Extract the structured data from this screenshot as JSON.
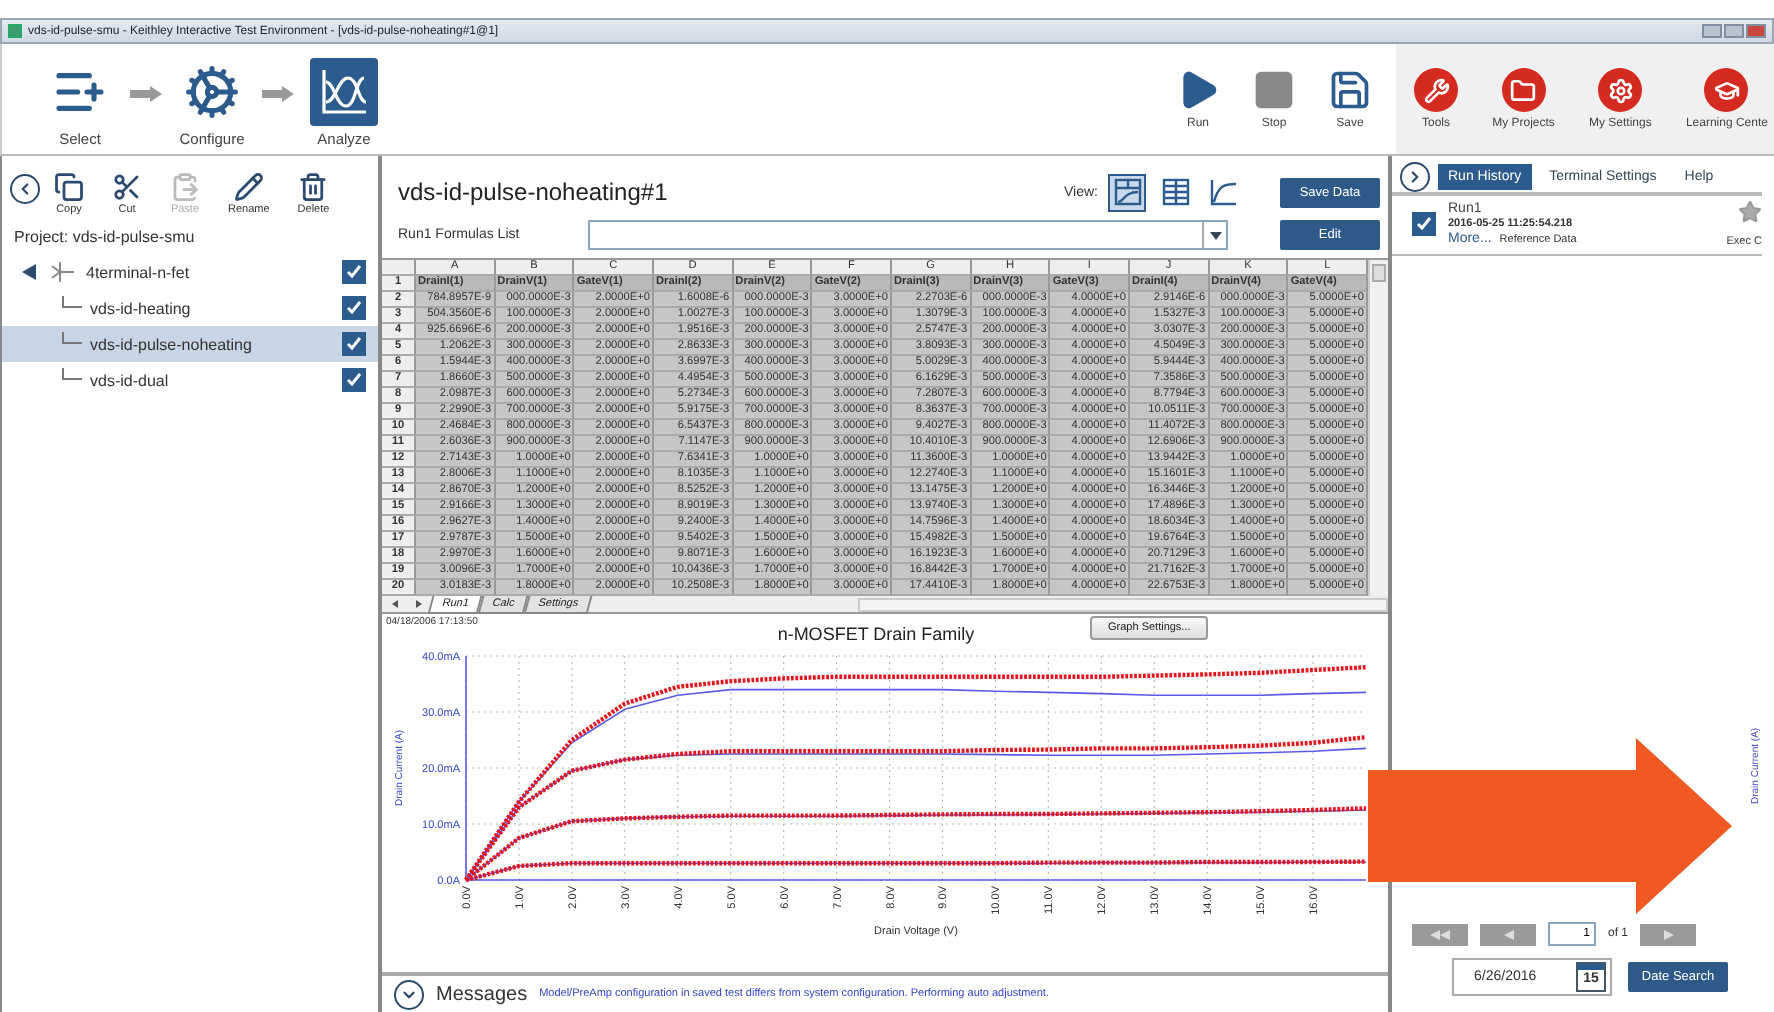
{
  "window": {
    "title": "vds-id-pulse-smu - Keithley Interactive Test Environment - [vds-id-pulse-noheating#1@1]"
  },
  "workflow": [
    {
      "label": "Select",
      "kind": "select",
      "selected": false
    },
    {
      "label": "Configure",
      "kind": "configure",
      "selected": false
    },
    {
      "label": "Analyze",
      "kind": "analyze",
      "selected": true
    }
  ],
  "run_controls": [
    {
      "label": "Run",
      "kind": "run"
    },
    {
      "label": "Stop",
      "kind": "stop"
    },
    {
      "label": "Save",
      "kind": "save"
    }
  ],
  "tools": [
    {
      "label": "Tools",
      "kind": "tools"
    },
    {
      "label": "My Projects",
      "kind": "projects"
    },
    {
      "label": "My Settings",
      "kind": "settings"
    },
    {
      "label": "Learning Cente",
      "kind": "learning"
    }
  ],
  "project_toolbar": [
    {
      "label": "Copy",
      "kind": "copy",
      "disabled": false
    },
    {
      "label": "Cut",
      "kind": "cut",
      "disabled": false
    },
    {
      "label": "Paste",
      "kind": "paste",
      "disabled": true
    },
    {
      "label": "Rename",
      "kind": "rename",
      "disabled": false
    },
    {
      "label": "Delete",
      "kind": "delete",
      "disabled": false
    }
  ],
  "project": {
    "label": "Project: vds-id-pulse-smu",
    "tree": [
      {
        "label": "4terminal-n-fet",
        "expanded": true,
        "checked": true,
        "selected": false,
        "children": [
          {
            "label": "vds-id-heating",
            "checked": true,
            "selected": false
          },
          {
            "label": "vds-id-pulse-noheating",
            "checked": true,
            "selected": true
          },
          {
            "label": "vds-id-dual",
            "checked": true,
            "selected": false
          }
        ]
      }
    ]
  },
  "test": {
    "title": "vds-id-pulse-noheating#1",
    "view_label": "View:",
    "views": [
      {
        "kind": "split",
        "selected": true
      },
      {
        "kind": "sheet",
        "selected": false
      },
      {
        "kind": "graph",
        "selected": false
      }
    ],
    "save_button": "Save Data",
    "formulas_label": "Run1 Formulas List",
    "edit_button": "Edit"
  },
  "sheet": {
    "column_letters": [
      "A",
      "B",
      "C",
      "D",
      "E",
      "F",
      "G",
      "H",
      "I",
      "J",
      "K",
      "L"
    ],
    "rows": [
      {
        "number": "1",
        "cells": [
          "DrainI(1)",
          "DrainV(1)",
          "GateV(1)",
          "DrainI(2)",
          "DrainV(2)",
          "GateV(2)",
          "DrainI(3)",
          "DrainV(3)",
          "GateV(3)",
          "DrainI(4)",
          "DrainV(4)",
          "GateV(4)"
        ]
      },
      {
        "number": "2",
        "cells": [
          "784.8957E-9",
          "000.0000E-3",
          "2.0000E+0",
          "1.6008E-6",
          "000.0000E-3",
          "3.0000E+0",
          "2.2703E-6",
          "000.0000E-3",
          "4.0000E+0",
          "2.9146E-6",
          "000.0000E-3",
          "5.0000E+0"
        ]
      },
      {
        "number": "3",
        "cells": [
          "504.3560E-6",
          "100.0000E-3",
          "2.0000E+0",
          "1.0027E-3",
          "100.0000E-3",
          "3.0000E+0",
          "1.3079E-3",
          "100.0000E-3",
          "4.0000E+0",
          "1.5327E-3",
          "100.0000E-3",
          "5.0000E+0"
        ]
      },
      {
        "number": "4",
        "cells": [
          "925.6696E-6",
          "200.0000E-3",
          "2.0000E+0",
          "1.9516E-3",
          "200.0000E-3",
          "3.0000E+0",
          "2.5747E-3",
          "200.0000E-3",
          "4.0000E+0",
          "3.0307E-3",
          "200.0000E-3",
          "5.0000E+0"
        ]
      },
      {
        "number": "5",
        "cells": [
          "1.2062E-3",
          "300.0000E-3",
          "2.0000E+0",
          "2.8633E-3",
          "300.0000E-3",
          "3.0000E+0",
          "3.8093E-3",
          "300.0000E-3",
          "4.0000E+0",
          "4.5049E-3",
          "300.0000E-3",
          "5.0000E+0"
        ]
      },
      {
        "number": "6",
        "cells": [
          "1.5944E-3",
          "400.0000E-3",
          "2.0000E+0",
          "3.6997E-3",
          "400.0000E-3",
          "3.0000E+0",
          "5.0029E-3",
          "400.0000E-3",
          "4.0000E+0",
          "5.9444E-3",
          "400.0000E-3",
          "5.0000E+0"
        ]
      },
      {
        "number": "7",
        "cells": [
          "1.8660E-3",
          "500.0000E-3",
          "2.0000E+0",
          "4.4954E-3",
          "500.0000E-3",
          "3.0000E+0",
          "6.1629E-3",
          "500.0000E-3",
          "4.0000E+0",
          "7.3586E-3",
          "500.0000E-3",
          "5.0000E+0"
        ]
      },
      {
        "number": "8",
        "cells": [
          "2.0987E-3",
          "600.0000E-3",
          "2.0000E+0",
          "5.2734E-3",
          "600.0000E-3",
          "3.0000E+0",
          "7.2807E-3",
          "600.0000E-3",
          "4.0000E+0",
          "8.7794E-3",
          "600.0000E-3",
          "5.0000E+0"
        ]
      },
      {
        "number": "9",
        "cells": [
          "2.2990E-3",
          "700.0000E-3",
          "2.0000E+0",
          "5.9175E-3",
          "700.0000E-3",
          "3.0000E+0",
          "8.3637E-3",
          "700.0000E-3",
          "4.0000E+0",
          "10.0511E-3",
          "700.0000E-3",
          "5.0000E+0"
        ]
      },
      {
        "number": "10",
        "cells": [
          "2.4684E-3",
          "800.0000E-3",
          "2.0000E+0",
          "6.5437E-3",
          "800.0000E-3",
          "3.0000E+0",
          "9.4027E-3",
          "800.0000E-3",
          "4.0000E+0",
          "11.4072E-3",
          "800.0000E-3",
          "5.0000E+0"
        ]
      },
      {
        "number": "11",
        "cells": [
          "2.6036E-3",
          "900.0000E-3",
          "2.0000E+0",
          "7.1147E-3",
          "900.0000E-3",
          "3.0000E+0",
          "10.4010E-3",
          "900.0000E-3",
          "4.0000E+0",
          "12.6906E-3",
          "900.0000E-3",
          "5.0000E+0"
        ]
      },
      {
        "number": "12",
        "cells": [
          "2.7143E-3",
          "1.0000E+0",
          "2.0000E+0",
          "7.6341E-3",
          "1.0000E+0",
          "3.0000E+0",
          "11.3600E-3",
          "1.0000E+0",
          "4.0000E+0",
          "13.9442E-3",
          "1.0000E+0",
          "5.0000E+0"
        ]
      },
      {
        "number": "13",
        "cells": [
          "2.8006E-3",
          "1.1000E+0",
          "2.0000E+0",
          "8.1035E-3",
          "1.1000E+0",
          "3.0000E+0",
          "12.2740E-3",
          "1.1000E+0",
          "4.0000E+0",
          "15.1601E-3",
          "1.1000E+0",
          "5.0000E+0"
        ]
      },
      {
        "number": "14",
        "cells": [
          "2.8670E-3",
          "1.2000E+0",
          "2.0000E+0",
          "8.5252E-3",
          "1.2000E+0",
          "3.0000E+0",
          "13.1475E-3",
          "1.2000E+0",
          "4.0000E+0",
          "16.3446E-3",
          "1.2000E+0",
          "5.0000E+0"
        ]
      },
      {
        "number": "15",
        "cells": [
          "2.9166E-3",
          "1.3000E+0",
          "2.0000E+0",
          "8.9019E-3",
          "1.3000E+0",
          "3.0000E+0",
          "13.9740E-3",
          "1.3000E+0",
          "4.0000E+0",
          "17.4896E-3",
          "1.3000E+0",
          "5.0000E+0"
        ]
      },
      {
        "number": "16",
        "cells": [
          "2.9627E-3",
          "1.4000E+0",
          "2.0000E+0",
          "9.2400E-3",
          "1.4000E+0",
          "3.0000E+0",
          "14.7596E-3",
          "1.4000E+0",
          "4.0000E+0",
          "18.6034E-3",
          "1.4000E+0",
          "5.0000E+0"
        ]
      },
      {
        "number": "17",
        "cells": [
          "2.9787E-3",
          "1.5000E+0",
          "2.0000E+0",
          "9.5402E-3",
          "1.5000E+0",
          "3.0000E+0",
          "15.4982E-3",
          "1.5000E+0",
          "4.0000E+0",
          "19.6764E-3",
          "1.5000E+0",
          "5.0000E+0"
        ]
      },
      {
        "number": "18",
        "cells": [
          "2.9970E-3",
          "1.6000E+0",
          "2.0000E+0",
          "9.8071E-3",
          "1.6000E+0",
          "3.0000E+0",
          "16.1923E-3",
          "1.6000E+0",
          "4.0000E+0",
          "20.7129E-3",
          "1.6000E+0",
          "5.0000E+0"
        ]
      },
      {
        "number": "19",
        "cells": [
          "3.0096E-3",
          "1.7000E+0",
          "2.0000E+0",
          "10.0436E-3",
          "1.7000E+0",
          "3.0000E+0",
          "16.8442E-3",
          "1.7000E+0",
          "4.0000E+0",
          "21.7162E-3",
          "1.7000E+0",
          "5.0000E+0"
        ]
      },
      {
        "number": "20",
        "cells": [
          "3.0183E-3",
          "1.8000E+0",
          "2.0000E+0",
          "10.2508E-3",
          "1.8000E+0",
          "3.0000E+0",
          "17.4410E-3",
          "1.8000E+0",
          "4.0000E+0",
          "22.6753E-3",
          "1.8000E+0",
          "5.0000E+0"
        ]
      }
    ],
    "tabs": [
      {
        "label": "Run1",
        "selected": true
      },
      {
        "label": "Calc",
        "selected": false
      },
      {
        "label": "Settings",
        "selected": false
      }
    ]
  },
  "graph": {
    "timestamp": "04/18/2006 17:13:50",
    "settings_button": "Graph Settings...",
    "chart_data": {
      "type": "line",
      "title": "n-MOSFET Drain Family",
      "xlabel": "Drain Voltage (V)",
      "ylabel": "Drain Current (A)",
      "x": [
        0,
        1,
        2,
        3,
        4,
        5,
        6,
        7,
        8,
        9,
        10,
        11,
        12,
        13,
        14,
        15,
        16,
        17
      ],
      "series": [
        {
          "color": "#e8141c",
          "line_style": "dotted",
          "values": [
            0,
            14,
            25,
            31.5,
            34.5,
            35.5,
            36,
            36.3,
            36.3,
            36.3,
            36.3,
            36.3,
            36.3,
            36.5,
            36.7,
            37,
            37.5,
            38
          ]
        },
        {
          "color": "#e8141c",
          "line_style": "dotted",
          "values": [
            0,
            13,
            19.5,
            21.5,
            22.5,
            23,
            23,
            23,
            23,
            23,
            23.2,
            23.3,
            23.5,
            23.5,
            23.7,
            24,
            24.5,
            25.5
          ]
        },
        {
          "color": "#e8141c",
          "line_style": "dotted",
          "values": [
            0,
            7.5,
            10.5,
            11,
            11.3,
            11.5,
            11.5,
            11.5,
            11.6,
            11.7,
            11.8,
            11.8,
            11.9,
            12,
            12.1,
            12.3,
            12.5,
            12.8
          ]
        },
        {
          "color": "#e8141c",
          "line_style": "dotted",
          "values": [
            0,
            2.5,
            3,
            3,
            3,
            3,
            3,
            3,
            3,
            3,
            3,
            3.1,
            3.1,
            3.1,
            3.2,
            3.2,
            3.2,
            3.3
          ]
        },
        {
          "color": "#5a5ae6",
          "line_style": "solid",
          "values": [
            0,
            14,
            24.5,
            30.5,
            33,
            34,
            34,
            34,
            34,
            34,
            33.7,
            33.5,
            33.3,
            33,
            33,
            33,
            33.3,
            33.5
          ]
        },
        {
          "color": "#5a5ae6",
          "line_style": "solid",
          "values": [
            0,
            13,
            19.5,
            21.5,
            22.3,
            22.5,
            22.5,
            22.5,
            22.5,
            22.5,
            22.4,
            22.3,
            22.3,
            22.3,
            22.5,
            22.7,
            23,
            23.5
          ]
        },
        {
          "color": "#5a5ae6",
          "line_style": "solid",
          "values": [
            0,
            7.5,
            10.5,
            11,
            11.3,
            11.4,
            11.4,
            11.4,
            11.5,
            11.6,
            11.6,
            11.7,
            11.8,
            11.9,
            12,
            12.1,
            12.3,
            12.5
          ]
        },
        {
          "color": "#5a5ae6",
          "line_style": "solid",
          "values": [
            0,
            2.5,
            3,
            3,
            3,
            3,
            3,
            3,
            3,
            3,
            3,
            3,
            3.1,
            3.1,
            3.1,
            3.1,
            3.2,
            3.2
          ]
        }
      ],
      "xlim": [
        0,
        17
      ],
      "ylim": [
        0,
        40
      ],
      "grid": true,
      "xticks": [
        {
          "value": 0,
          "label": "0.0V"
        },
        {
          "value": 1,
          "label": "1.0V"
        },
        {
          "value": 2,
          "label": "2.0V"
        },
        {
          "value": 3,
          "label": "3.0V"
        },
        {
          "value": 4,
          "label": "4.0V"
        },
        {
          "value": 5,
          "label": "5.0V"
        },
        {
          "value": 6,
          "label": "6.0V"
        },
        {
          "value": 7,
          "label": "7.0V"
        },
        {
          "value": 8,
          "label": "8.0V"
        },
        {
          "value": 9,
          "label": "9.0V"
        },
        {
          "value": 10,
          "label": "10.0V"
        },
        {
          "value": 11,
          "label": "11.0V"
        },
        {
          "value": 12,
          "label": "12.0V"
        },
        {
          "value": 13,
          "label": "13.0V"
        },
        {
          "value": 14,
          "label": "14.0V"
        },
        {
          "value": 15,
          "label": "15.0V"
        },
        {
          "value": 16,
          "label": "16.0V"
        }
      ],
      "yticks": [
        {
          "value": 0,
          "label": "0.0A"
        },
        {
          "value": 10,
          "label": "10.0mA"
        },
        {
          "value": 20,
          "label": "20.0mA"
        },
        {
          "value": 30,
          "label": "30.0mA"
        },
        {
          "value": 40,
          "label": "40.0mA"
        }
      ]
    }
  },
  "messages": {
    "title": "Messages",
    "text": "Model/PreAmp configuration in saved test differs from system configuration. Performing auto adjustment."
  },
  "run_history": {
    "tabs": [
      {
        "label": "Run History",
        "selected": true
      },
      {
        "label": "Terminal Settings",
        "selected": false
      },
      {
        "label": "Help",
        "selected": false
      }
    ],
    "runs": [
      {
        "name": "Run1",
        "timestamp": "2016-05-25 11:25:54.218",
        "checked": true,
        "more": "More...",
        "reference": "Reference Data",
        "column_2": "Exec C"
      }
    ],
    "page": "1",
    "page_count": "of 1",
    "date": "6/26/2016",
    "calendar_day": "15",
    "date_search": "Date Search"
  },
  "side_label": "Drain Current (A)"
}
